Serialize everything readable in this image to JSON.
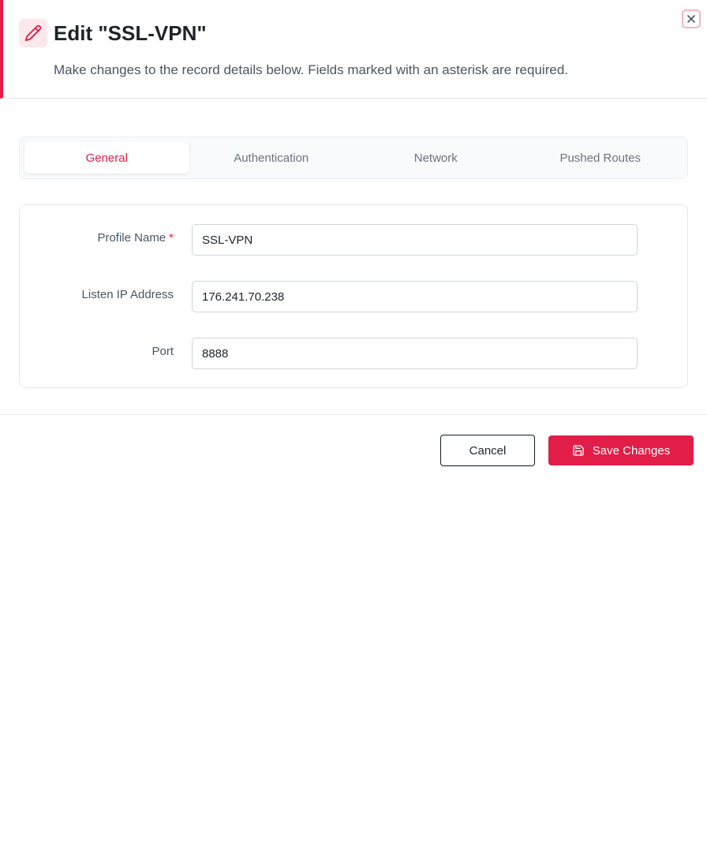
{
  "dialog": {
    "title": "Edit \"SSL-VPN\"",
    "subtitle": "Make changes to the record details below. Fields marked with an asterisk are required.",
    "header_icon": "pencil-icon",
    "close_icon": "close-icon",
    "accent_color": "#e11d48"
  },
  "tabs": [
    {
      "label": "General",
      "active": true
    },
    {
      "label": "Authentication",
      "active": false
    },
    {
      "label": "Network",
      "active": false
    },
    {
      "label": "Pushed Routes",
      "active": false
    }
  ],
  "form": {
    "fields": [
      {
        "label": "Profile Name",
        "required_marker": "*",
        "value": "SSL-VPN"
      },
      {
        "label": "Listen IP Address",
        "value": "176.241.70.238"
      },
      {
        "label": "Port",
        "value": "8888"
      }
    ]
  },
  "footer": {
    "cancel_label": "Cancel",
    "save_label": "Save Changes",
    "save_icon": "save-icon"
  }
}
